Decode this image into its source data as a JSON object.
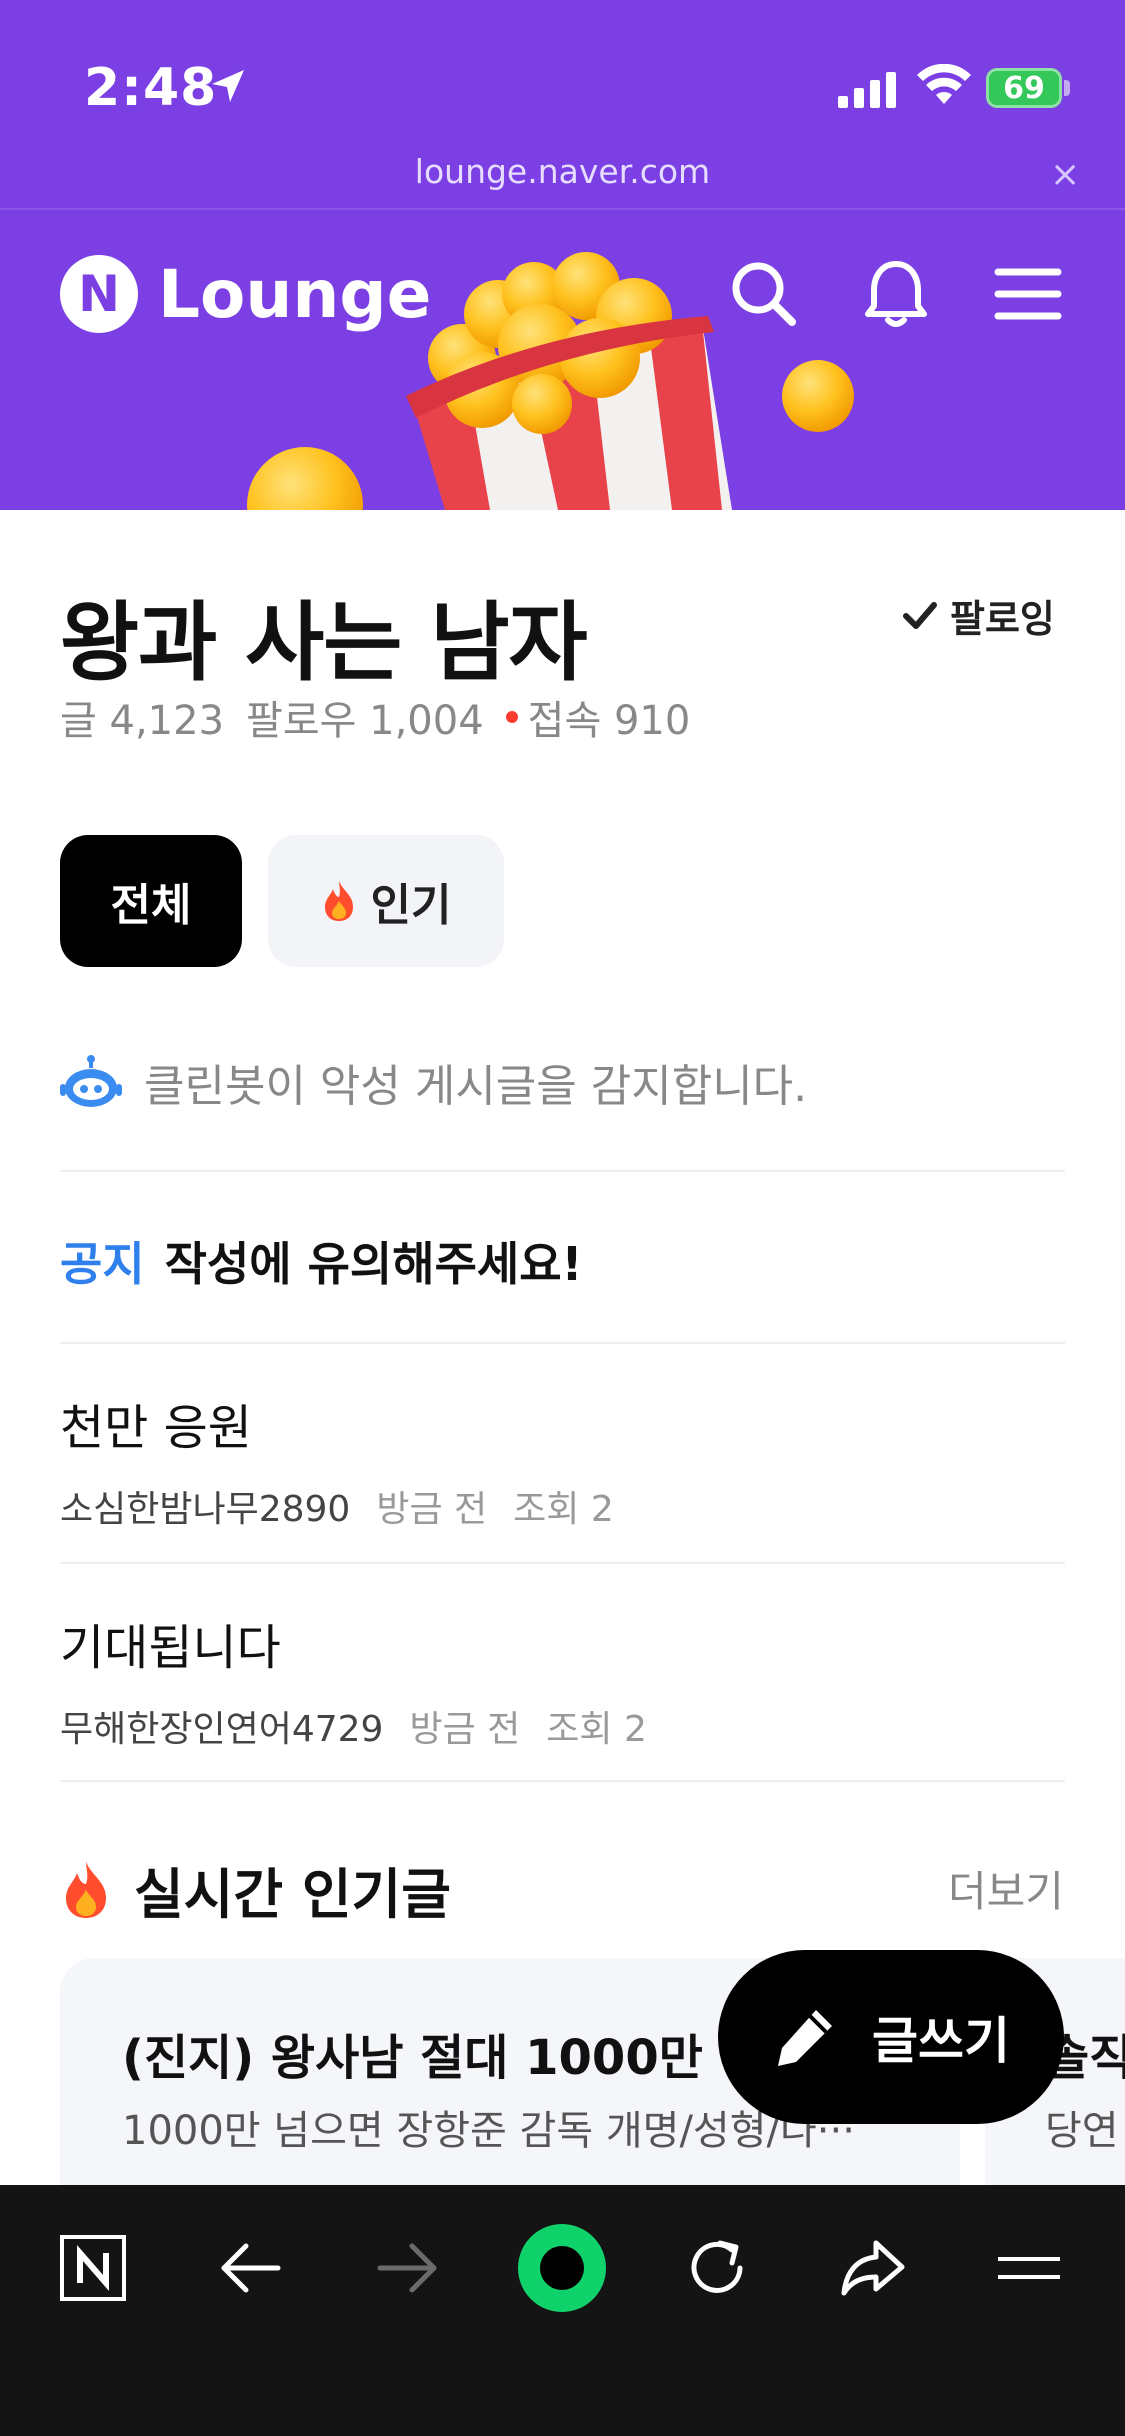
{
  "status": {
    "time": "2:48",
    "battery": "69",
    "battery_color": "#34c759"
  },
  "browser": {
    "url": "lounge.naver.com",
    "close_icon": "×"
  },
  "header": {
    "logo_letter": "N",
    "brand": "Lounge",
    "accent_color": "#7b3fe4",
    "icons": [
      "search-icon",
      "bell-icon",
      "hamburger-menu-icon"
    ]
  },
  "lounge": {
    "title": "왕과 사는 남자",
    "follow_label": "팔로잉",
    "stats": {
      "posts": "글 4,123",
      "followers": "팔로우 1,004",
      "online": "접속 910"
    }
  },
  "tabs": [
    {
      "label": "전체",
      "active": true
    },
    {
      "label": "인기",
      "active": false
    }
  ],
  "cleanbot": {
    "text": "클린봇이 악성 게시글을 감지합니다."
  },
  "notice": {
    "tag": "공지",
    "text": "작성에 유의해주세요!"
  },
  "posts": [
    {
      "title": "천만 응원",
      "author": "소심한밤나무2890",
      "time": "방금 전",
      "views": "조회 2"
    },
    {
      "title": "기대됩니다",
      "author": "무해한장인연어4729",
      "time": "방금 전",
      "views": "조회 2"
    }
  ],
  "realtime": {
    "title": "실시간 인기글",
    "more": "더보기",
    "cards": [
      {
        "title": "(진지) 왕사남 절대 1000만 넘",
        "sub": "1000만 넘으면 장항준 감독 개명/성형/나···"
      },
      {
        "title": "솔직",
        "sub": "당연"
      }
    ]
  },
  "fab": {
    "label": "글쓰기"
  },
  "bottom_nav": [
    "naver-home-icon",
    "back-arrow-icon",
    "forward-arrow-icon",
    "green-dot-icon",
    "refresh-icon",
    "share-icon",
    "menu-icon"
  ]
}
